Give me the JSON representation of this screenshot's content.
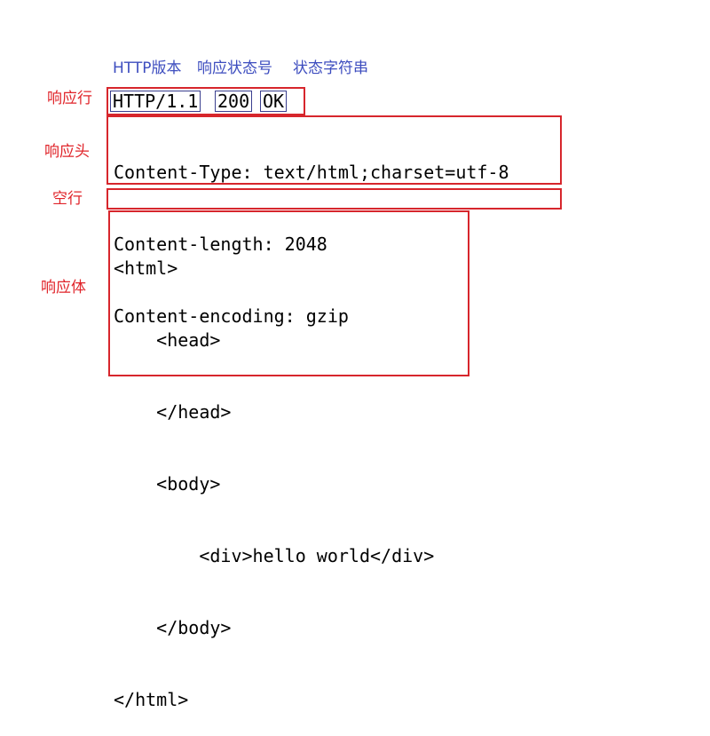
{
  "header_labels": {
    "http_version": "HTTP版本",
    "status_code": "响应状态号",
    "status_text": "状态字符串"
  },
  "side_labels": {
    "response_line": "响应行",
    "response_headers": "响应头",
    "blank_line": "空行",
    "response_body": "响应体"
  },
  "response_line": {
    "version": "HTTP/1.1",
    "code": "200",
    "reason": "OK"
  },
  "response_headers": [
    "Content-Type: text/html;charset=utf-8",
    "Content-length: 2048",
    "Content-encoding: gzip"
  ],
  "response_body": [
    "<html>",
    "    <head>",
    "    </head>",
    "    <body>",
    "        <div>hello world</div>",
    "    </body>",
    "</html>"
  ],
  "colors": {
    "header_label": "#3d4dbf",
    "side_label": "#e0242a",
    "box_border": "#d7262c",
    "token_border": "#3a3f8f"
  }
}
